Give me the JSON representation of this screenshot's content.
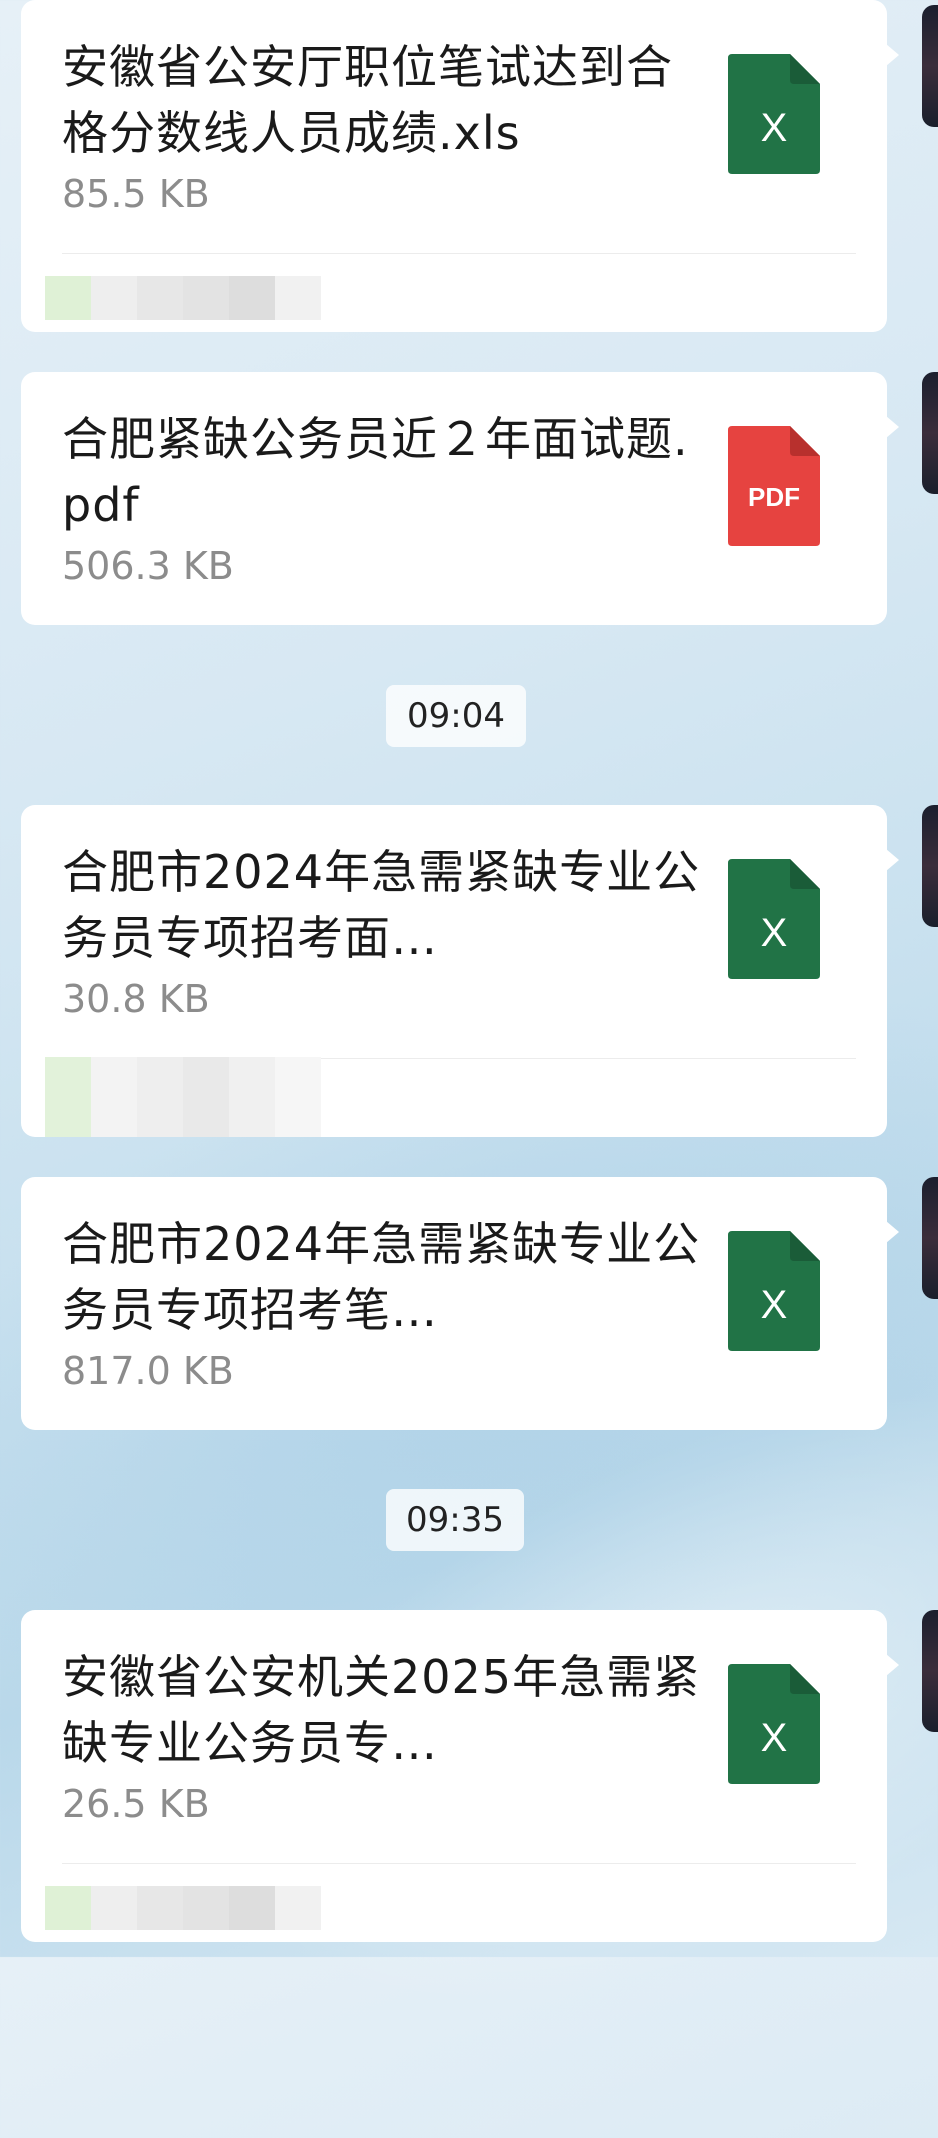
{
  "messages": [
    {
      "filename": "安徽省公安厅职位笔试达到合格分数线人员成绩.xls",
      "size": "85.5 KB",
      "icon": "excel-file-icon",
      "icon_label": "X",
      "icon_color": "#217346"
    },
    {
      "filename": "合肥紧缺公务员近２年面试题.pdf",
      "size": "506.3 KB",
      "icon": "pdf-file-icon",
      "icon_label": "PDF",
      "icon_color": "#e64340"
    },
    {
      "filename": "合肥市2024年急需紧缺专业公务员专项招考面…",
      "size": "30.8 KB",
      "icon": "excel-file-icon",
      "icon_label": "X",
      "icon_color": "#217346"
    },
    {
      "filename": "合肥市2024年急需紧缺专业公务员专项招考笔…",
      "size": "817.0 KB",
      "icon": "excel-file-icon",
      "icon_label": "X",
      "icon_color": "#217346"
    },
    {
      "filename": "安徽省公安机关2025年急需紧缺专业公务员专…",
      "size": "26.5 KB",
      "icon": "excel-file-icon",
      "icon_label": "X",
      "icon_color": "#217346"
    }
  ],
  "timestamps": [
    "09:04",
    "09:35"
  ]
}
